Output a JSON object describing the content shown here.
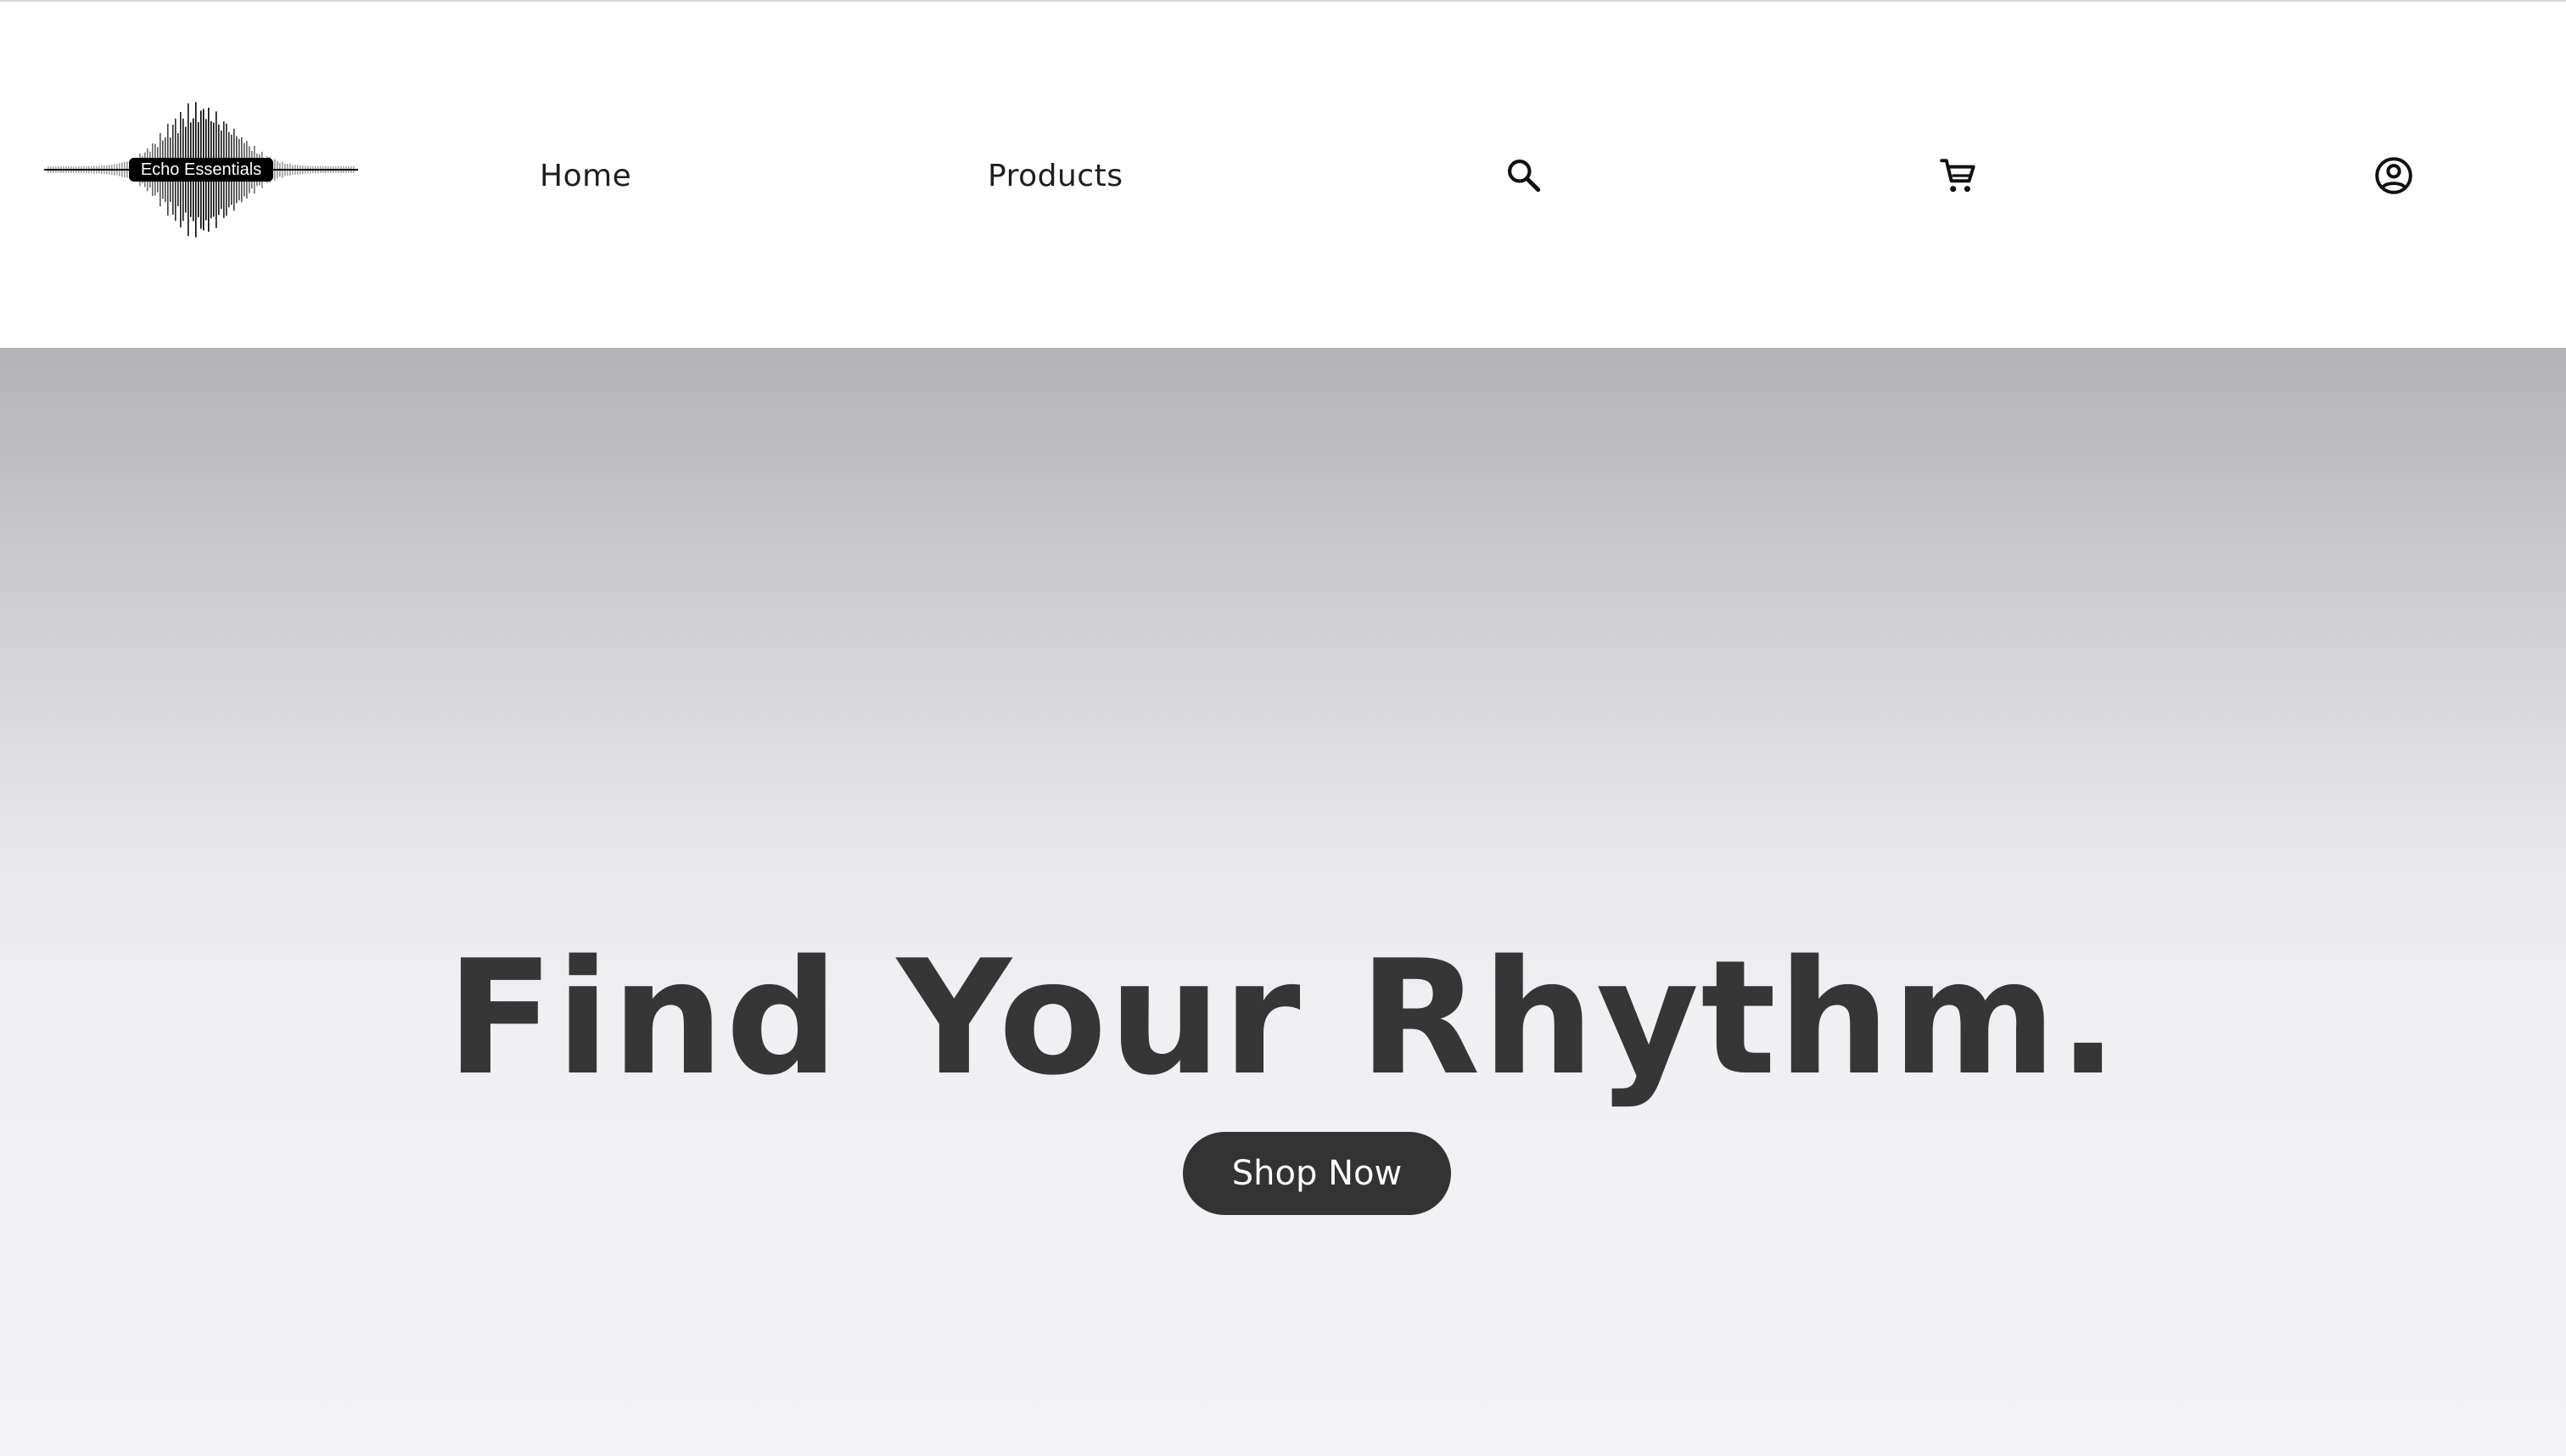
{
  "brand": {
    "name": "Echo Essentials",
    "logo_icon": "soundwave-logo"
  },
  "nav": {
    "items": [
      {
        "label": "Home"
      },
      {
        "label": "Products"
      }
    ],
    "icons": {
      "search": "search-icon",
      "cart": "cart-icon",
      "account": "account-icon"
    }
  },
  "hero": {
    "title": "Find Your Rhythm.",
    "cta_label": "Shop Now"
  },
  "colors": {
    "text_dark": "#363636",
    "button_bg": "#333333",
    "button_text": "#ffffff",
    "header_bg": "#ffffff"
  }
}
